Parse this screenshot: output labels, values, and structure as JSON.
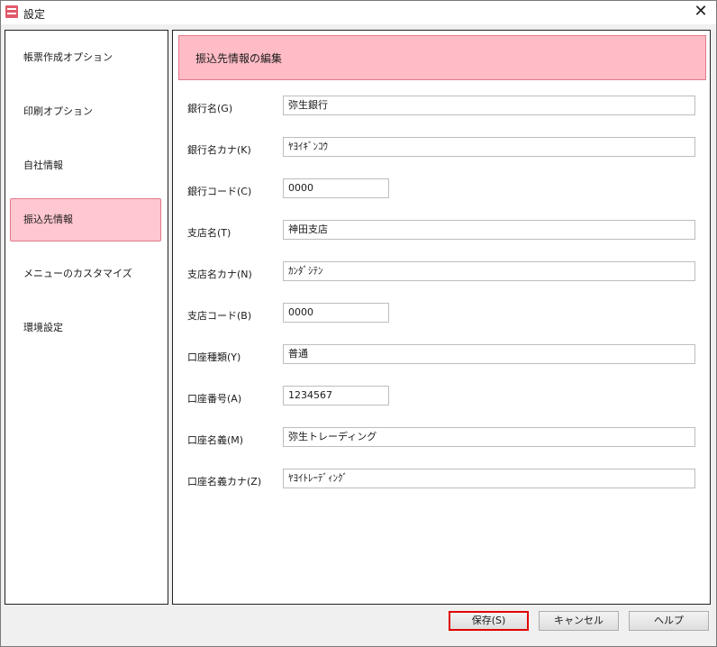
{
  "window": {
    "title": "設定",
    "close_label": "✕",
    "icon": "app-icon"
  },
  "sidebar": {
    "items": [
      {
        "label": "帳票作成オプション",
        "active": false
      },
      {
        "label": "印刷オプション",
        "active": false
      },
      {
        "label": "自社情報",
        "active": false
      },
      {
        "label": "振込先情報",
        "active": true
      },
      {
        "label": "メニューのカスタマイズ",
        "active": false
      },
      {
        "label": "環境設定",
        "active": false
      }
    ]
  },
  "main": {
    "header": "振込先情報の編集",
    "fields": [
      {
        "label": "銀行名(G)",
        "value": "弥生銀行"
      },
      {
        "label": "銀行名カナ(K)",
        "value": "ﾔﾖｲｷﾞﾝｺｳ"
      },
      {
        "label": "銀行コード(C)",
        "value": "0000"
      },
      {
        "label": "支店名(T)",
        "value": "神田支店"
      },
      {
        "label": "支店名カナ(N)",
        "value": "ｶﾝﾀﾞｼﾃﾝ"
      },
      {
        "label": "支店コード(B)",
        "value": "0000"
      },
      {
        "label": "口座種類(Y)",
        "value": "普通"
      },
      {
        "label": "口座番号(A)",
        "value": "1234567"
      },
      {
        "label": "口座名義(M)",
        "value": "弥生トレーディング"
      },
      {
        "label": "口座名義カナ(Z)",
        "value": "ﾔﾖｲﾄﾚｰﾃﾞｨﾝｸﾞ"
      }
    ]
  },
  "buttons": {
    "save": "保存(S)",
    "cancel": "キャンセル",
    "help": "ヘルプ"
  },
  "colors": {
    "accent": "#ffbcc6",
    "accent_border": "#e07a89",
    "primary_outline": "#e00000"
  }
}
